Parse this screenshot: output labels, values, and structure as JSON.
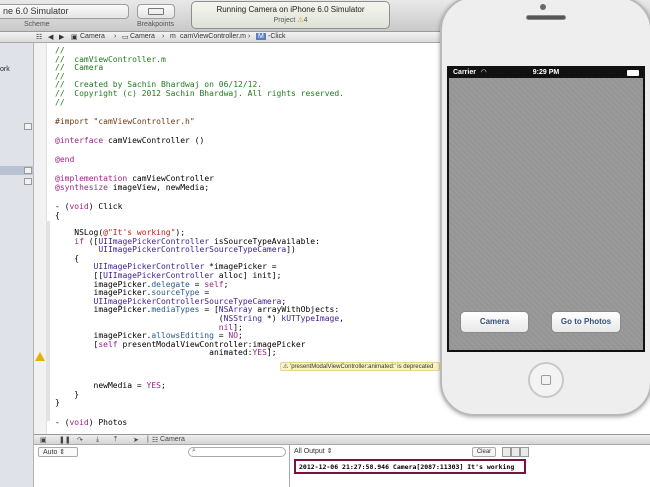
{
  "toolbar": {
    "scheme_value": "ne 6.0 Simulator",
    "scheme_label": "Scheme",
    "breakpoints_label": "Breakpoints",
    "activity_title": "Running Camera on iPhone 6.0 Simulator",
    "activity_project": "Project",
    "activity_warning_count": "4"
  },
  "jump_bar": {
    "back": "◀",
    "forward": "▶",
    "items": [
      "Camera",
      "Camera",
      "camViewController.m",
      "M",
      "-Click"
    ]
  },
  "sidebar": {
    "partial_text": "ork"
  },
  "code_lines": [
    "//",
    "//  camViewController.m",
    "//  Camera",
    "//",
    "//  Created by Sachin Bhardwaj on 06/12/12.",
    "//  Copyright (c) 2012 Sachin Bhardwaj. All rights reserved.",
    "//",
    "",
    "#import \"camViewController.h\"",
    "",
    "@interface camViewController ()",
    "",
    "@end",
    "",
    "@implementation camViewController",
    "@synthesize imageView, newMedia;",
    "",
    "- (void) Click",
    "{",
    "",
    "    NSLog(@\"It's working\");",
    "    if ([UIImagePickerController isSourceTypeAvailable:",
    "         UIImagePickerControllerSourceTypeCamera])",
    "    {",
    "        UIImagePickerController *imagePicker =",
    "        [[UIImagePickerController alloc] init];",
    "        imagePicker.delegate = self;",
    "        imagePicker.sourceType =",
    "        UIImagePickerControllerSourceTypeCamera;",
    "        imagePicker.mediaTypes = [NSArray arrayWithObjects:",
    "                                  (NSString *) kUTTypeImage,",
    "                                  nil];",
    "        imagePicker.allowsEditing = NO;",
    "        [self presentModalViewController:imagePicker",
    "                                animated:YES];",
    "",
    "",
    "        newMedia = YES;",
    "    }",
    "}",
    "",
    "- (void) Photos"
  ],
  "warning": {
    "message": "'presentModalViewController:animated:' is deprecated"
  },
  "debug_bar": {
    "target": "Camera"
  },
  "variables": {
    "scope": "Auto"
  },
  "console": {
    "filter": "All Output",
    "clear_label": "Clear",
    "output": "2012-12-06 21:27:58.946 Camera[2087:11303] It's working"
  },
  "simulator": {
    "carrier": "Carrier",
    "time": "9:29 PM",
    "camera_button": "Camera",
    "photos_button": "Go to Photos"
  }
}
